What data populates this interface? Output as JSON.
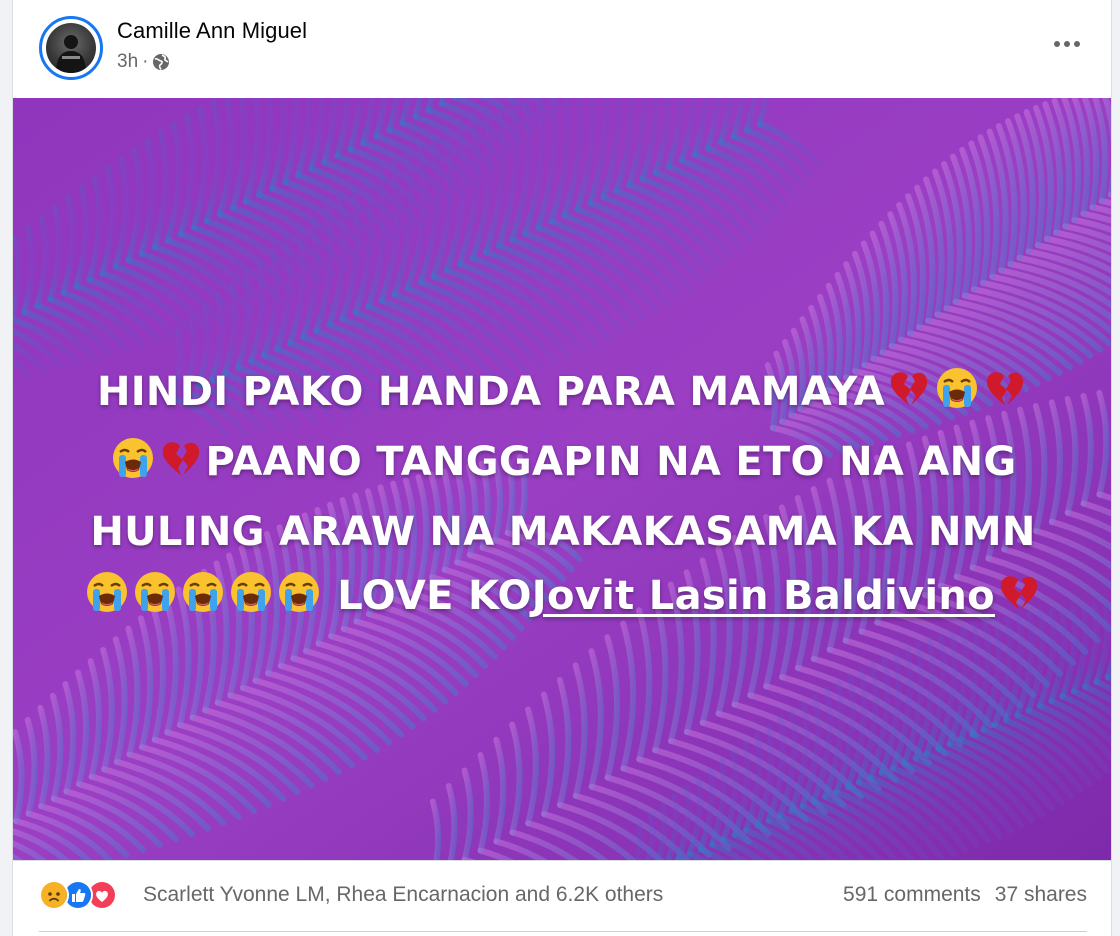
{
  "post": {
    "author": "Camille Ann Miguel",
    "time": "3h",
    "separator": "·",
    "privacy_icon": "globe-icon",
    "more_icon": "more-horizontal-icon"
  },
  "post_text": {
    "line1": "HINDI PAKO HANDA PARA MAMAYA",
    "line2": "PAANO TANGGAPIN NA ETO NA ANG",
    "line3": "HULING ARAW NA MAKAKASAMA KA NMN",
    "line4_prefix": "LOVE KO",
    "mention": "Jovit Lasin Baldivino",
    "emojis": [
      "broken-heart",
      "loudly-crying-face"
    ]
  },
  "colors": {
    "background_purple": "#8a2fb8",
    "leaf_blue": "#2f7fc9",
    "leaf_pink": "#d77fe0",
    "text": "#ffffff",
    "fb_blue": "#1877f2"
  },
  "engagement": {
    "reaction_icons": [
      "sad-reaction-icon",
      "like-reaction-icon",
      "love-reaction-icon"
    ],
    "names": "Scarlett Yvonne LM, Rhea Encarnacion and 6.2K others",
    "comments": "591 comments",
    "shares": "37 shares"
  }
}
